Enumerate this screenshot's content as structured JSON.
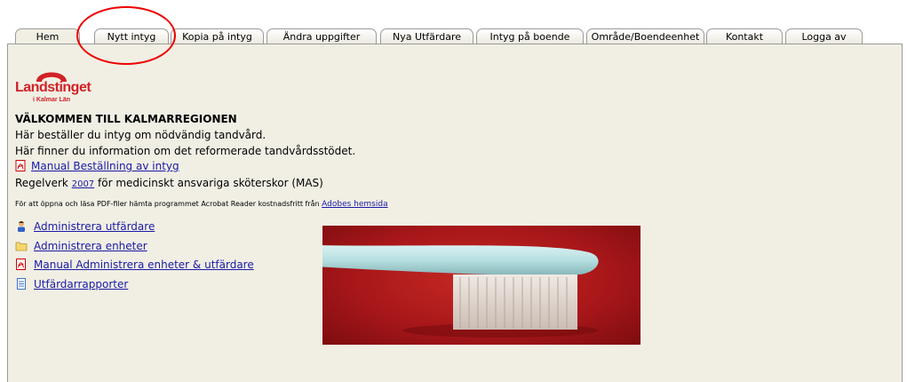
{
  "tabs": [
    {
      "label": "Hem",
      "active": true
    },
    {
      "label": "Nytt intyg"
    },
    {
      "label": "Kopia på intyg"
    },
    {
      "label": "Ändra uppgifter"
    },
    {
      "label": "Nya Utfärdare"
    },
    {
      "label": "Intyg på boende"
    },
    {
      "label": "Område/Boendeenhet"
    },
    {
      "label": "Kontakt"
    },
    {
      "label": "Logga av"
    }
  ],
  "logo": {
    "text": "Landstinget",
    "sub": "i Kalmar Län"
  },
  "main": {
    "heading": "VÄLKOMMEN TILL KALMARREGIONEN",
    "line1": "Här beställer du intyg om nödvändig tandvård.",
    "line2": "Här finner du information om det reformerade tandvårdsstödet.",
    "manual_link": "Manual Beställning av intyg",
    "regelverk_prefix": "Regelverk",
    "regelverk_link": "2007",
    "regelverk_suffix": "för medicinskt ansvariga sköterskor (MAS)",
    "pdf_note": "För att öppna och läsa PDF-filer hämta programmet Acrobat Reader kostnadsfritt från",
    "pdf_note_link": "Adobes hemsida"
  },
  "menu": [
    {
      "label": "Administrera utfärdare",
      "icon": "person-icon"
    },
    {
      "label": "Administrera enheter",
      "icon": "folder-icon"
    },
    {
      "label": "Manual Administrera enheter & utfärdare",
      "icon": "pdf-icon"
    },
    {
      "label": "Utfärdarrapporter",
      "icon": "document-icon"
    }
  ],
  "colors": {
    "brand": "#d12127",
    "panel": "#f1efe4",
    "link": "#1a1aa6",
    "highlight": "#e00000"
  }
}
